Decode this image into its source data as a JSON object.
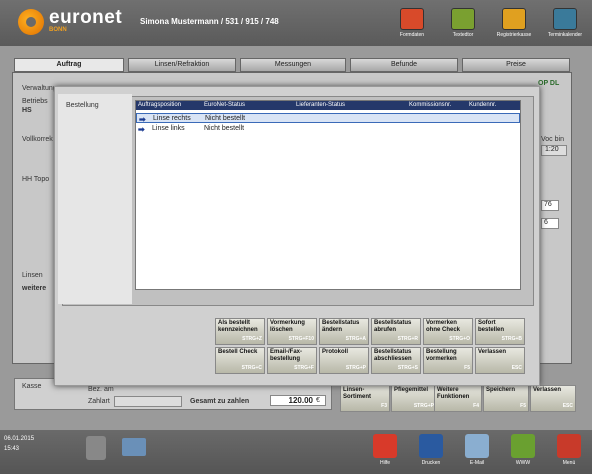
{
  "header": {
    "brand": "euronet",
    "brand_sub": "BONN",
    "user": "Simona Mustermann / 531 / 915 / 748",
    "buttons": [
      {
        "label": "Formdaten",
        "icon": "glasses-icon"
      },
      {
        "label": "Textedtor",
        "icon": "pencil-icon"
      },
      {
        "label": "Registrierkasse",
        "icon": "register-icon"
      },
      {
        "label": "Terminkalender",
        "icon": "calendar-icon"
      }
    ]
  },
  "tabs": [
    "Auftrag",
    "Linsen/Refraktion",
    "Messungen",
    "Befunde",
    "Preise"
  ],
  "background": {
    "verwaltung": "Verwaltung",
    "betriebsstatus": "Betriebs",
    "hs": "HS",
    "vollkorrektur": "Vollkorrek",
    "hh_topo": "HH Topo",
    "linsen": "Linsen",
    "weitere": "weitere",
    "kasse": "Kasse",
    "zahlart": "Zahlart",
    "gesamt_label": "Gesamt zu zahlen",
    "gesamt_value": "120.00",
    "currency": "€",
    "vocbin_label": "Voc bin",
    "vocbin_value": "1:20",
    "val76": "76",
    "val6": "6",
    "bez_am": "Bez. am",
    "opdl": "OP DL"
  },
  "dialog": {
    "section_label": "Bestellung",
    "columns": [
      "Auftragsposition",
      "EuroNet-Status",
      "Lieferanten-Status",
      "Kommissionsnr.",
      "Kundennr."
    ],
    "rows": [
      {
        "position": "Linse rechts",
        "status": "Nicht bestellt"
      },
      {
        "position": "Linse links",
        "status": "Nicht bestellt"
      }
    ],
    "function_keys": [
      {
        "label": "Als bestellt kennzeichnen",
        "key": "STRG+Z"
      },
      {
        "label": "Vormerkung löschen",
        "key": "STRG+F10"
      },
      {
        "label": "Bestellstatus ändern",
        "key": "STRG+A"
      },
      {
        "label": "Bestellstatus abrufen",
        "key": "STRG+R"
      },
      {
        "label": "Vormerken ohne Check",
        "key": "STRG+O"
      },
      {
        "label": "Sofort bestellen",
        "key": "STRG+B"
      },
      {
        "label": "Bestell Check",
        "key": "STRG+C"
      },
      {
        "label": "Email-/Fax-bestellung",
        "key": "STRG+F"
      },
      {
        "label": "Protokoll",
        "key": "STRG+P"
      },
      {
        "label": "Bestellstatus abschliessen",
        "key": "STRG+S"
      },
      {
        "label": "Bestellung vormerken",
        "key": "F5"
      },
      {
        "label": "Verlassen",
        "key": "ESC"
      }
    ]
  },
  "bottom_keys": [
    {
      "label": "Linsen-Sortiment",
      "key": "F3"
    },
    {
      "label": "Pflegemittel",
      "key": "STRG+P"
    },
    {
      "label": "Weitere Funktionen",
      "key": "F4"
    },
    {
      "label": "Speichern",
      "key": "F5"
    },
    {
      "label": "Verlassen",
      "key": "ESC"
    }
  ],
  "footer": {
    "date": "06.01.2015",
    "time": "15:43",
    "buttons": [
      {
        "label": "Hilfe",
        "icon": "help-icon"
      },
      {
        "label": "Drucken",
        "icon": "printer-icon"
      },
      {
        "label": "E-Mail",
        "icon": "mail-icon"
      },
      {
        "label": "WWW",
        "icon": "globe-icon"
      },
      {
        "label": "Menü",
        "icon": "menu-icon"
      }
    ]
  }
}
